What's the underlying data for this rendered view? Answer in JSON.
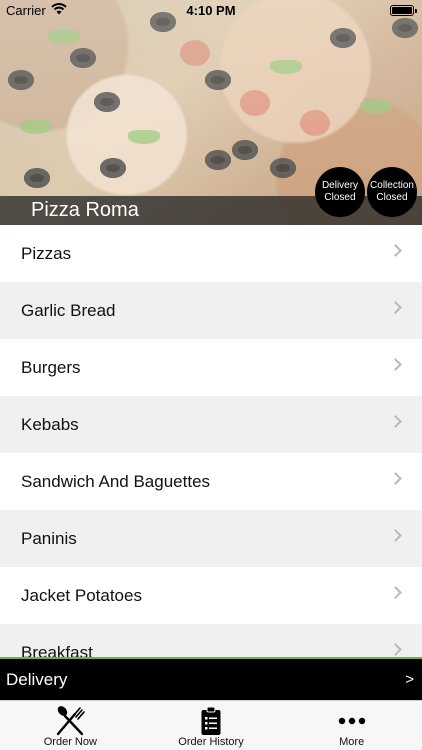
{
  "status_bar": {
    "carrier": "Carrier",
    "time": "4:10 PM"
  },
  "restaurant": {
    "name": "Pizza Roma",
    "delivery_status": {
      "line1": "Delivery",
      "line2": "Closed"
    },
    "collection_status": {
      "line1": "Collection",
      "line2": "Closed"
    }
  },
  "menu": {
    "items": [
      {
        "label": "Pizzas"
      },
      {
        "label": "Garlic Bread"
      },
      {
        "label": "Burgers"
      },
      {
        "label": "Kebabs"
      },
      {
        "label": "Sandwich And Baguettes"
      },
      {
        "label": "Paninis"
      },
      {
        "label": "Jacket Potatoes"
      },
      {
        "label": "Breakfast"
      }
    ]
  },
  "delivery_bar": {
    "label": "Delivery",
    "arrow": ">"
  },
  "tab_bar": {
    "tabs": [
      {
        "label": "Order Now",
        "icon": "fork-knife-icon"
      },
      {
        "label": "Order History",
        "icon": "clipboard-icon"
      },
      {
        "label": "More",
        "icon": "more-dots-icon"
      }
    ]
  },
  "colors": {
    "accent_green": "#6ab04c",
    "bar_black": "#000000",
    "row_alt": "#f0f0f0"
  }
}
